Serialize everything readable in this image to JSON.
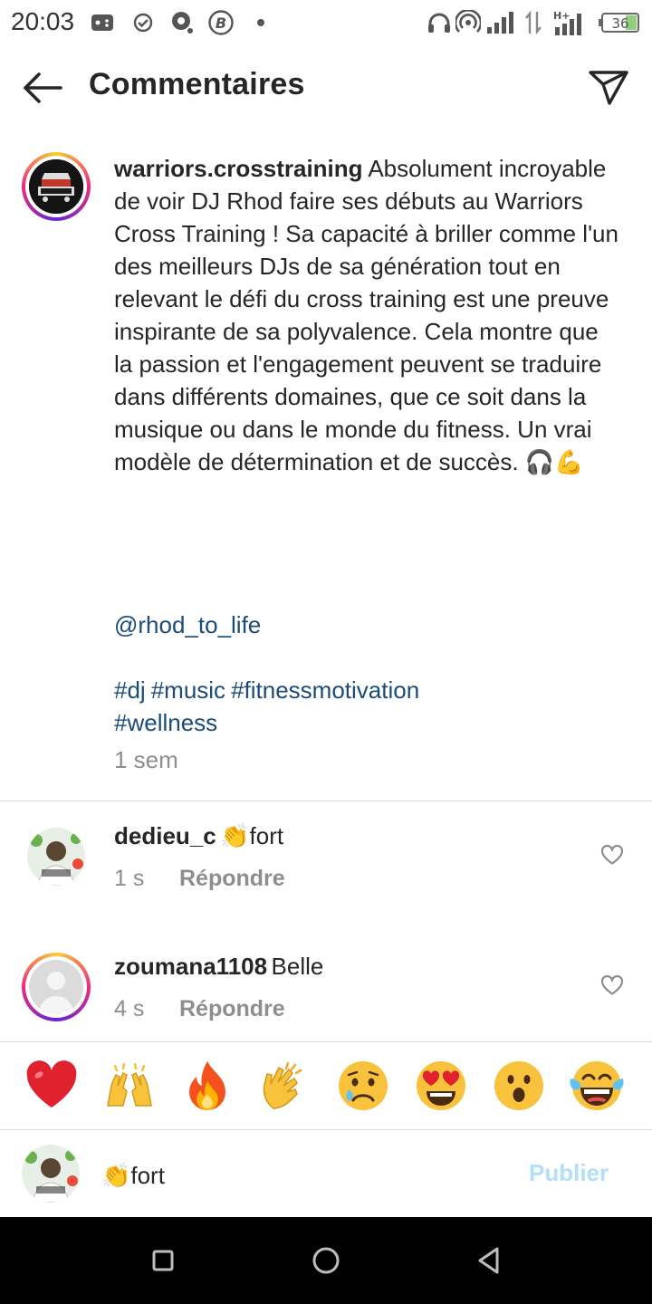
{
  "status_bar": {
    "time": "20:03",
    "battery": "36",
    "network": "H+"
  },
  "header": {
    "title": "Commentaires"
  },
  "caption": {
    "username": "warriors.crosstraining",
    "text": "Absolument incroyable de voir DJ Rhod faire ses débuts au Warriors Cross Training ! Sa capacité à briller comme l'un des meilleurs DJs de sa génération tout en relevant le défi du cross training est une preuve inspirante de sa polyvalence. Cela montre que la passion et l'engagement peuvent se traduire dans différents domaines, que ce soit dans la musique ou dans le monde du fitness. Un vrai modèle de détermination et de succès. 🎧💪",
    "mention": "@rhod_to_life",
    "hashtags": [
      "#dj",
      "#music",
      "#fitnessmotivation",
      "#wellness"
    ],
    "time": "1 sem",
    "avatar_text": [
      "WARRIORS",
      "CROSS TRAINING"
    ]
  },
  "comments": [
    {
      "username": "dedieu_c",
      "text": "👏fort",
      "time": "1 s",
      "reply_label": "Répondre"
    },
    {
      "username": "zoumana1108",
      "text": "Belle",
      "time": "4 s",
      "reply_label": "Répondre"
    }
  ],
  "emoji_bar": [
    "❤️",
    "🙌",
    "🔥",
    "👏",
    "😢",
    "😍",
    "😮",
    "😂"
  ],
  "composer": {
    "value": "👏fort",
    "publish_label": "Publier"
  },
  "colors": {
    "link": "#1a4b7a",
    "muted": "#8e8e8e",
    "publish_disabled": "#b2dffc",
    "divider": "#dbdbdb"
  },
  "icons": {
    "back": "arrow-left-icon",
    "share": "paper-plane-icon",
    "like": "heart-outline-icon"
  }
}
